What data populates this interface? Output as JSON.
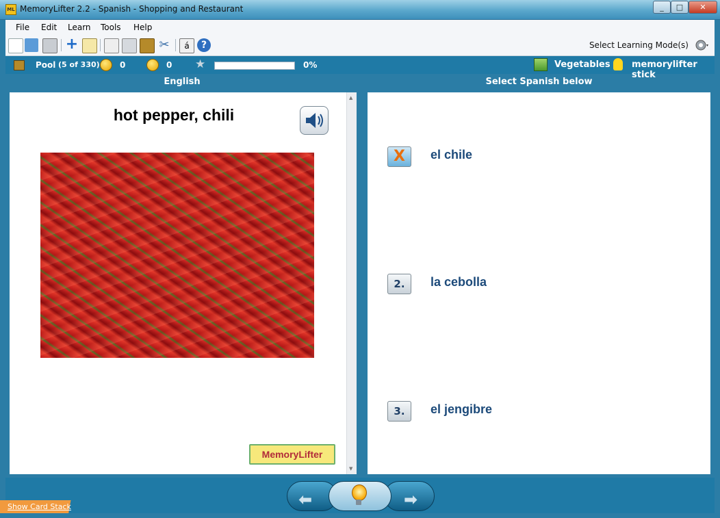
{
  "window": {
    "title": "MemoryLifter 2.2 - Spanish - Shopping and Restaurant",
    "icon_label": "ML"
  },
  "menu": {
    "items": [
      "File",
      "Edit",
      "Learn",
      "Tools",
      "Help"
    ]
  },
  "toolbar": {
    "mode_label": "Select Learning Mode(s)",
    "char_button": "á"
  },
  "status": {
    "pool_label": "Pool",
    "pool_count": "(5 of 330)",
    "correct_count": "0",
    "wrong_count": "0",
    "progress_percent": "0%",
    "progress_value": 0,
    "chapter": "Vegetables",
    "user": "memorylifter stick"
  },
  "question_panel": {
    "header": "English",
    "word": "hot pepper, chili",
    "image_description": "chili-peppers-photo",
    "logo_text": "MemoryLifter"
  },
  "answer_panel": {
    "header": "Select Spanish below",
    "choices": [
      {
        "marker": "X",
        "text": "el chile",
        "state": "wrong"
      },
      {
        "marker": "2.",
        "text": "la cebolla",
        "state": "normal"
      },
      {
        "marker": "3.",
        "text": "el jengibre",
        "state": "normal"
      }
    ]
  },
  "footer": {
    "show_card_stack": "Show Card Stack"
  },
  "colors": {
    "accent": "#1f7aa6",
    "answer_text": "#1c4a7a",
    "logo_text": "#b12a3a"
  }
}
